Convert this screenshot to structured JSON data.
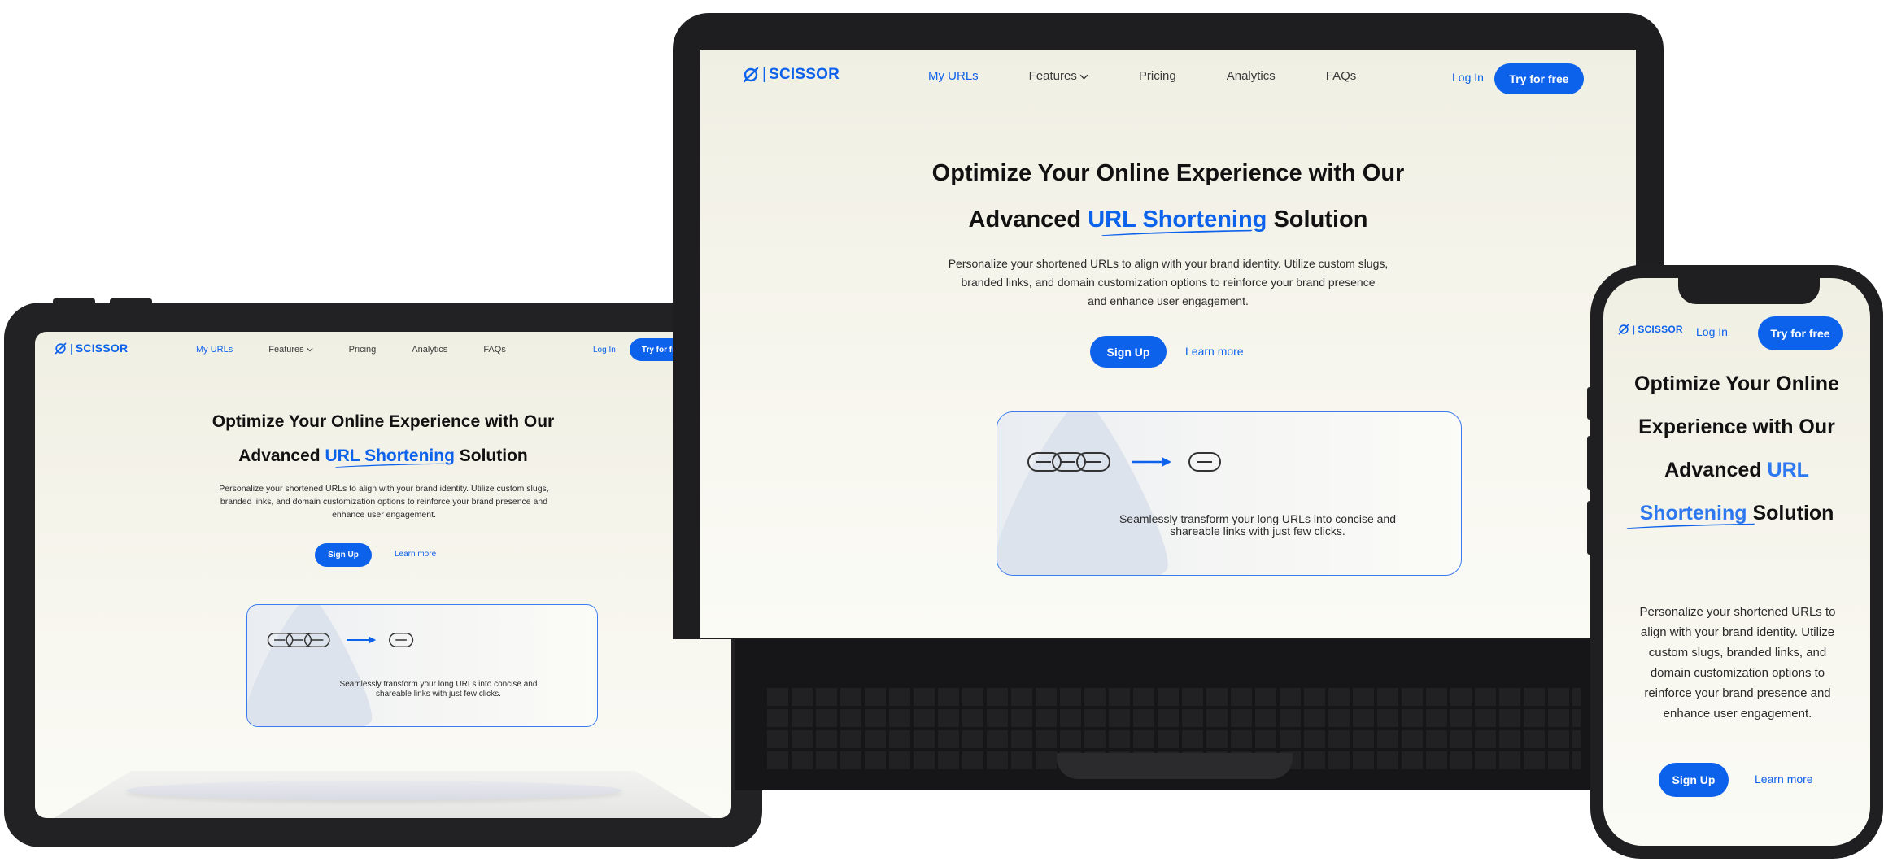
{
  "brand": {
    "name": "SCISSOR",
    "separator": "|",
    "accent": "#0d62ec"
  },
  "nav": {
    "my_urls": "My URLs",
    "features": "Features",
    "pricing": "Pricing",
    "analytics": "Analytics",
    "faqs": "FAQs"
  },
  "actions": {
    "login": "Log In",
    "try_free": "Try for free",
    "sign_up": "Sign Up",
    "learn_more": "Learn more"
  },
  "hero": {
    "line1": "Optimize Your Online Experience with Our",
    "line2_pre": "Advanced",
    "highlight": "URL Shortening",
    "line2_post": "Solution",
    "phone_line1": "Optimize Your Online",
    "phone_line2": "Experience with Our",
    "phone_line3": "Advanced",
    "phone_hl1": "URL",
    "phone_hl2": "Shortening",
    "phone_line4_post": "Solution"
  },
  "intro": {
    "laptop_lines": [
      "Personalize your shortened URLs to align with your brand identity. Utilize custom slugs,",
      "branded links, and domain customization options to reinforce your brand presence",
      "and enhance user engagement."
    ],
    "tablet_lines": [
      "Personalize your shortened URLs to align with your brand identity. Utilize custom slugs,",
      "branded links, and domain customization options to reinforce your brand presence and",
      "enhance user engagement."
    ],
    "phone_lines": [
      "Personalize your shortened URLs to",
      "align with your brand identity. Utilize",
      "custom slugs, branded links, and",
      "domain customization options to",
      "reinforce your brand presence and",
      "enhance user engagement."
    ]
  },
  "feature_card": {
    "caption_line1": "Seamlessly transform your long URLs into concise and",
    "caption_line2": "shareable links with just few clicks.",
    "icons": [
      "chain-link-icon",
      "arrow-right-icon",
      "short-link-icon"
    ]
  }
}
